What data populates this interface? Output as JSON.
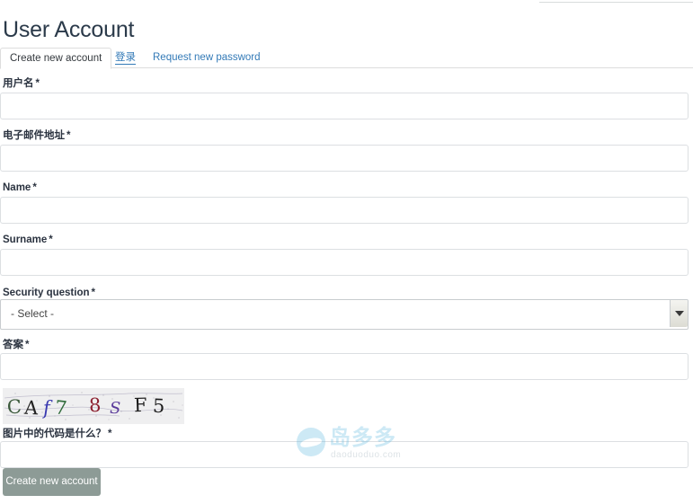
{
  "page": {
    "title": "User Account"
  },
  "tabs": [
    {
      "label": "Create new account",
      "active": true
    },
    {
      "label": "登录",
      "active": false
    },
    {
      "label": "Request new password",
      "active": false
    }
  ],
  "form": {
    "required_marker": "*",
    "fields": [
      {
        "name": "username",
        "label": "用户名",
        "required": true,
        "type": "text",
        "value": "",
        "placeholder": ""
      },
      {
        "name": "email",
        "label": "电子邮件地址",
        "required": true,
        "type": "text",
        "value": "",
        "placeholder": ""
      },
      {
        "name": "firstname",
        "label": "Name",
        "required": true,
        "type": "text",
        "value": "",
        "placeholder": ""
      },
      {
        "name": "surname",
        "label": "Surname",
        "required": true,
        "type": "text",
        "value": "",
        "placeholder": ""
      },
      {
        "name": "security-question",
        "label": "Security question",
        "required": true,
        "type": "select",
        "value": "- Select -",
        "placeholder": ""
      },
      {
        "name": "answer",
        "label": "答案",
        "required": true,
        "type": "text",
        "value": "",
        "placeholder": ""
      },
      {
        "name": "captcha-response",
        "label": "图片中的代码是什么？",
        "required": true,
        "type": "text",
        "value": "",
        "placeholder": ""
      }
    ],
    "select_options": [
      "- Select -"
    ],
    "submit_label": "Create new account"
  },
  "captcha": {
    "code": "CAf78SF5",
    "characters": [
      {
        "char": "C",
        "color": "#3c5a3c"
      },
      {
        "char": "A",
        "color": "#222222"
      },
      {
        "char": "f",
        "color": "#3a3ab0"
      },
      {
        "char": "7",
        "color": "#2f6b3a"
      },
      {
        "char": "8",
        "color": "#8c2030"
      },
      {
        "char": "S",
        "color": "#5a3a9a"
      },
      {
        "char": "F",
        "color": "#1c1c1c"
      },
      {
        "char": "5",
        "color": "#1c1c1c"
      }
    ],
    "background": "#efeff0"
  },
  "watermark": {
    "text_cn": "岛多多",
    "text_url": "daoduoduo.com",
    "color": "#5bb7e0"
  },
  "colors": {
    "title": "#2b3a4a",
    "link": "#337ab7",
    "submit_bg": "#8d9b96",
    "border": "#dcdfe2"
  }
}
